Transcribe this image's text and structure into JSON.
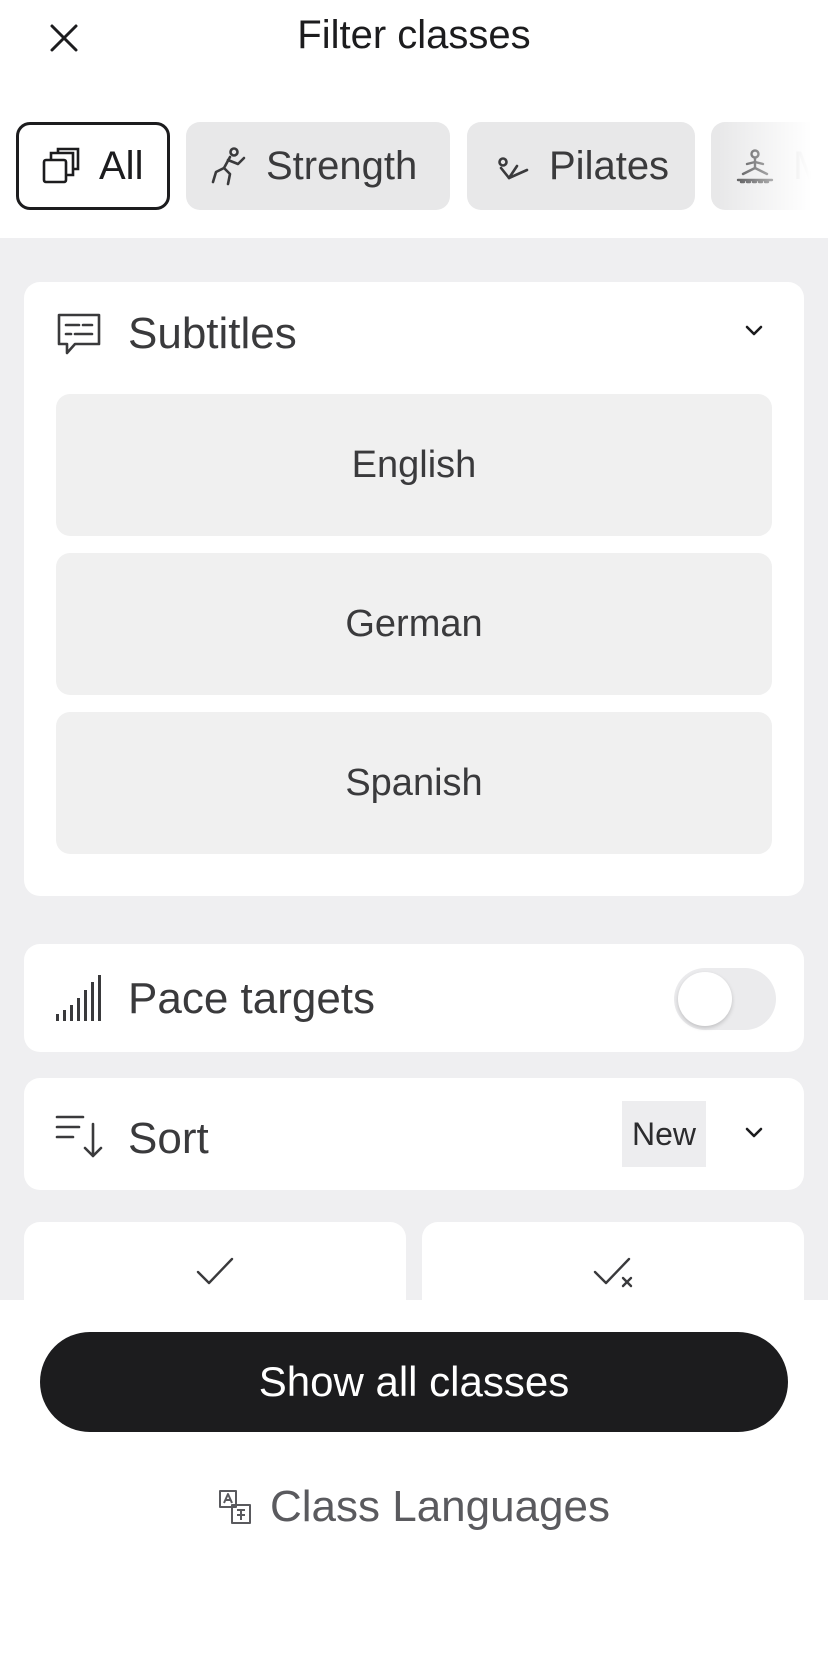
{
  "header": {
    "title": "Filter classes"
  },
  "chips": [
    {
      "label": "All",
      "icon": "stacked-squares-icon",
      "selected": true
    },
    {
      "label": "Strength",
      "icon": "strength-figure-icon",
      "selected": false
    },
    {
      "label": "Pilates",
      "icon": "pilates-figure-icon",
      "selected": false
    },
    {
      "label": "M",
      "icon": "meditation-figure-icon",
      "selected": false
    }
  ],
  "subtitles": {
    "title": "Subtitles",
    "icon": "subtitles-icon",
    "expanded": true,
    "options": [
      "English",
      "German",
      "Spanish"
    ]
  },
  "pace_targets": {
    "title": "Pace targets",
    "icon": "signal-bars-icon",
    "enabled": false
  },
  "sort": {
    "title": "Sort",
    "icon": "sort-descending-icon",
    "value": "New"
  },
  "completion_filters": [
    {
      "icon": "checkmark-icon"
    },
    {
      "icon": "checkmark-x-icon"
    }
  ],
  "footer": {
    "primary_button": "Show all classes",
    "class_languages_link": "Class Languages",
    "class_languages_icon": "translate-icon"
  },
  "colors": {
    "primary": "#1c1c1e",
    "background": "#efeff1",
    "chip_bg": "#e8e8e9"
  }
}
